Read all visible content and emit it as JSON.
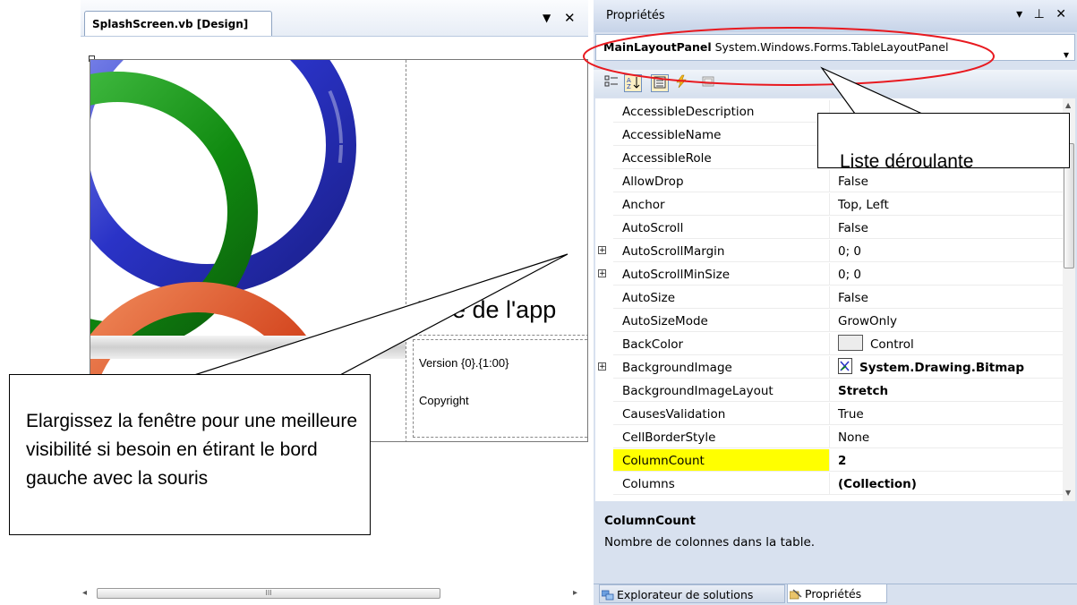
{
  "designer": {
    "tab_title": "SplashScreen.vb [Design]",
    "tab_dropdown": "▼",
    "tab_close": "✕",
    "splash": {
      "app_title": "Titre de l'app",
      "version": "Version {0}.{1:00}",
      "copyright": "Copyright"
    },
    "hscroll_left": "◂",
    "hscroll_right": "▸",
    "hscroll_grip": "III"
  },
  "properties": {
    "title": "Propriétés",
    "title_buttons": "▾ ⊥ ✕",
    "object_name": "MainLayoutPanel",
    "object_type": "System.Windows.Forms.TableLayoutPanel",
    "toolbar": {
      "categorized_icon": "categorized-icon",
      "alphabetical_icon": "alphabetical-icon",
      "properties_icon": "properties-icon",
      "events_icon": "events-icon",
      "property_pages_icon": "property-pages-icon"
    },
    "rows": [
      {
        "name": "AccessibleDescription",
        "value": "",
        "expandable": false,
        "bold": false
      },
      {
        "name": "AccessibleName",
        "value": "",
        "expandable": false,
        "bold": false
      },
      {
        "name": "AccessibleRole",
        "value": "",
        "expandable": false,
        "bold": false
      },
      {
        "name": "AllowDrop",
        "value": "False",
        "expandable": false,
        "bold": false
      },
      {
        "name": "Anchor",
        "value": "Top, Left",
        "expandable": false,
        "bold": false
      },
      {
        "name": "AutoScroll",
        "value": "False",
        "expandable": false,
        "bold": false
      },
      {
        "name": "AutoScrollMargin",
        "value": "0; 0",
        "expandable": true,
        "bold": false
      },
      {
        "name": "AutoScrollMinSize",
        "value": "0; 0",
        "expandable": true,
        "bold": false
      },
      {
        "name": "AutoSize",
        "value": "False",
        "expandable": false,
        "bold": false
      },
      {
        "name": "AutoSizeMode",
        "value": "GrowOnly",
        "expandable": false,
        "bold": false
      },
      {
        "name": "BackColor",
        "value": "Control",
        "expandable": false,
        "bold": false,
        "swatch": "#ececec"
      },
      {
        "name": "BackgroundImage",
        "value": "System.Drawing.Bitmap",
        "expandable": true,
        "bold": true,
        "icon": "bitmap-icon"
      },
      {
        "name": "BackgroundImageLayout",
        "value": "Stretch",
        "expandable": false,
        "bold": true
      },
      {
        "name": "CausesValidation",
        "value": "True",
        "expandable": false,
        "bold": false
      },
      {
        "name": "CellBorderStyle",
        "value": "None",
        "expandable": false,
        "bold": false
      },
      {
        "name": "ColumnCount",
        "value": "2",
        "expandable": false,
        "bold": true,
        "selected": true,
        "highlight": "#ffff00"
      },
      {
        "name": "Columns",
        "value": "(Collection)",
        "expandable": false,
        "bold": true
      }
    ],
    "description": {
      "title": "ColumnCount",
      "text": "Nombre de colonnes dans la table."
    },
    "bottom_tabs": [
      {
        "label": "Explorateur de solutions",
        "icon": "solution-explorer-icon"
      },
      {
        "label": "Propriétés",
        "icon": "properties-tab-icon"
      }
    ]
  },
  "annotations": {
    "left_callout": "Elargissez la fenêtre pour une meilleure visibilité si besoin en étirant le bord gauche avec la souris",
    "right_callout": "Liste déroulante",
    "ellipse_color": "#e8191f"
  }
}
